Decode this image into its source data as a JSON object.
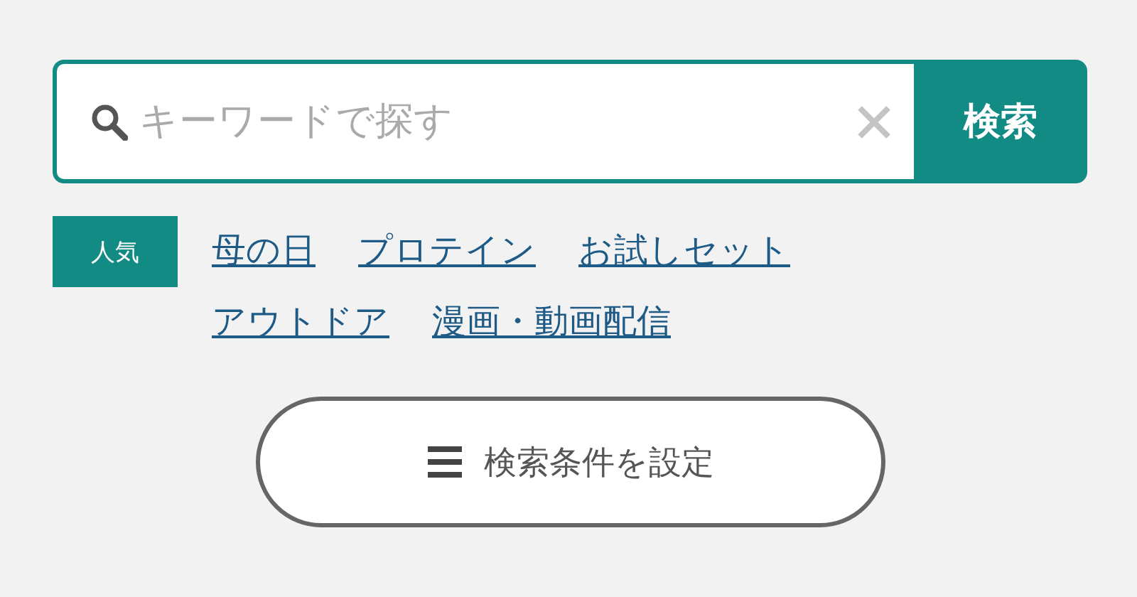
{
  "search": {
    "placeholder": "キーワードで探す",
    "button": "検索"
  },
  "popular": {
    "label": "人気",
    "links": [
      "母の日",
      "プロテイン",
      "お試しセット",
      "アウトドア",
      "漫画・動画配信"
    ]
  },
  "condition_button": {
    "label": "検索条件を設定"
  }
}
